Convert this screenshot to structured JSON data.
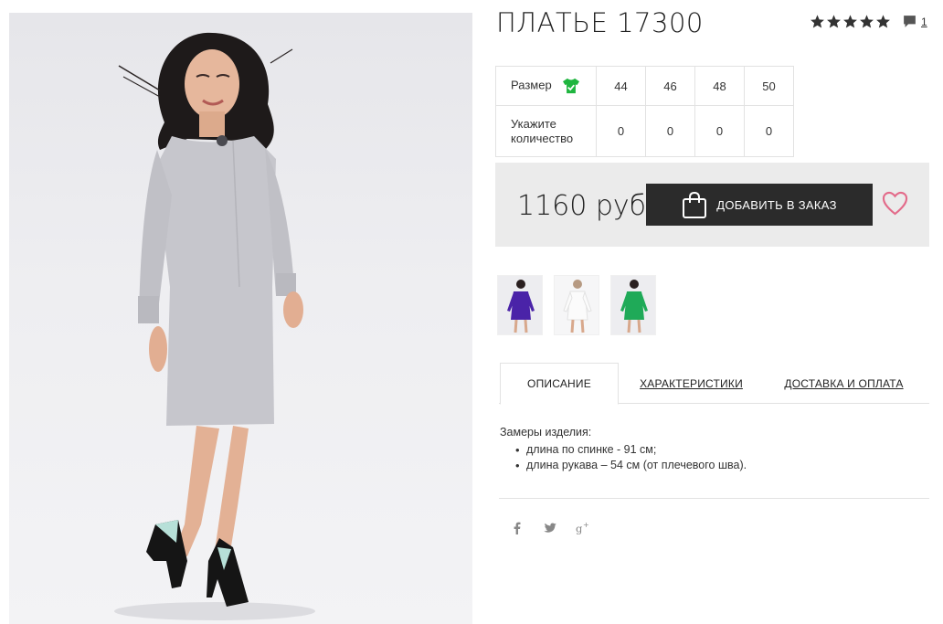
{
  "product": {
    "title": "ПЛАТЬЕ 17300",
    "rating_stars": 5,
    "comment_count": "1"
  },
  "sizes": {
    "size_label": "Размер",
    "qty_label": "Укажите количество",
    "items": [
      {
        "size": "44",
        "qty": "0"
      },
      {
        "size": "46",
        "qty": "0"
      },
      {
        "size": "48",
        "qty": "0"
      },
      {
        "size": "50",
        "qty": "0"
      }
    ]
  },
  "buy": {
    "price": "1160 руб",
    "add_label": "ДОБАВИТЬ В ЗАКАЗ"
  },
  "thumbnails": [
    {
      "name": "thumb-purple",
      "color": "#4a23a8"
    },
    {
      "name": "thumb-white",
      "color": "#f4f4f4"
    },
    {
      "name": "thumb-green",
      "color": "#1faa58"
    }
  ],
  "tabs": [
    {
      "label": "ОПИСАНИЕ",
      "active": true
    },
    {
      "label": "ХАРАКТЕРИСТИКИ",
      "active": false
    },
    {
      "label": "ДОСТАВКА И ОПЛАТА",
      "active": false
    }
  ],
  "description": {
    "heading": "Замеры изделия:",
    "items": [
      "длина по спинке - 91 см;",
      "длина рукава – 54 см (от плечевого шва)."
    ]
  },
  "social": [
    "facebook-icon",
    "twitter-icon",
    "google-plus-icon"
  ],
  "colors": {
    "accent_green": "#1fb53f",
    "heart_pink": "#e36b8a",
    "button_dark": "#2b2b2b",
    "band_gray": "#ebebeb"
  }
}
